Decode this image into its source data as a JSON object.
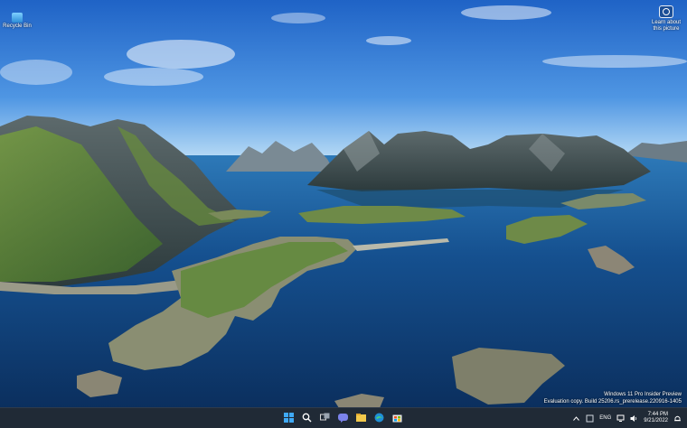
{
  "desktop": {
    "icons": [
      {
        "label": "Recycle Bin",
        "icon": "recycle-bin-icon"
      }
    ],
    "learn_widget": {
      "icon": "camera-icon",
      "line1": "Learn about",
      "line2": "this picture"
    },
    "watermark": {
      "line1": "Windows 11 Pro Insider Preview",
      "line2": "Evaluation copy. Build 25206.rs_prerelease.220916-1405"
    }
  },
  "taskbar": {
    "apps": [
      {
        "icon": "windows-start-icon"
      },
      {
        "icon": "search-icon"
      },
      {
        "icon": "task-view-icon"
      },
      {
        "icon": "teams-chat-icon"
      },
      {
        "icon": "file-explorer-icon"
      },
      {
        "icon": "edge-browser-icon"
      },
      {
        "icon": "microsoft-store-icon"
      }
    ],
    "tray": {
      "language": "ENG",
      "time": "7:44 PM",
      "date": "9/21/2022"
    }
  },
  "colors": {
    "taskbar_bg": "#202a36",
    "sky": "#2b6fc9",
    "sea": "#0f3f74"
  }
}
